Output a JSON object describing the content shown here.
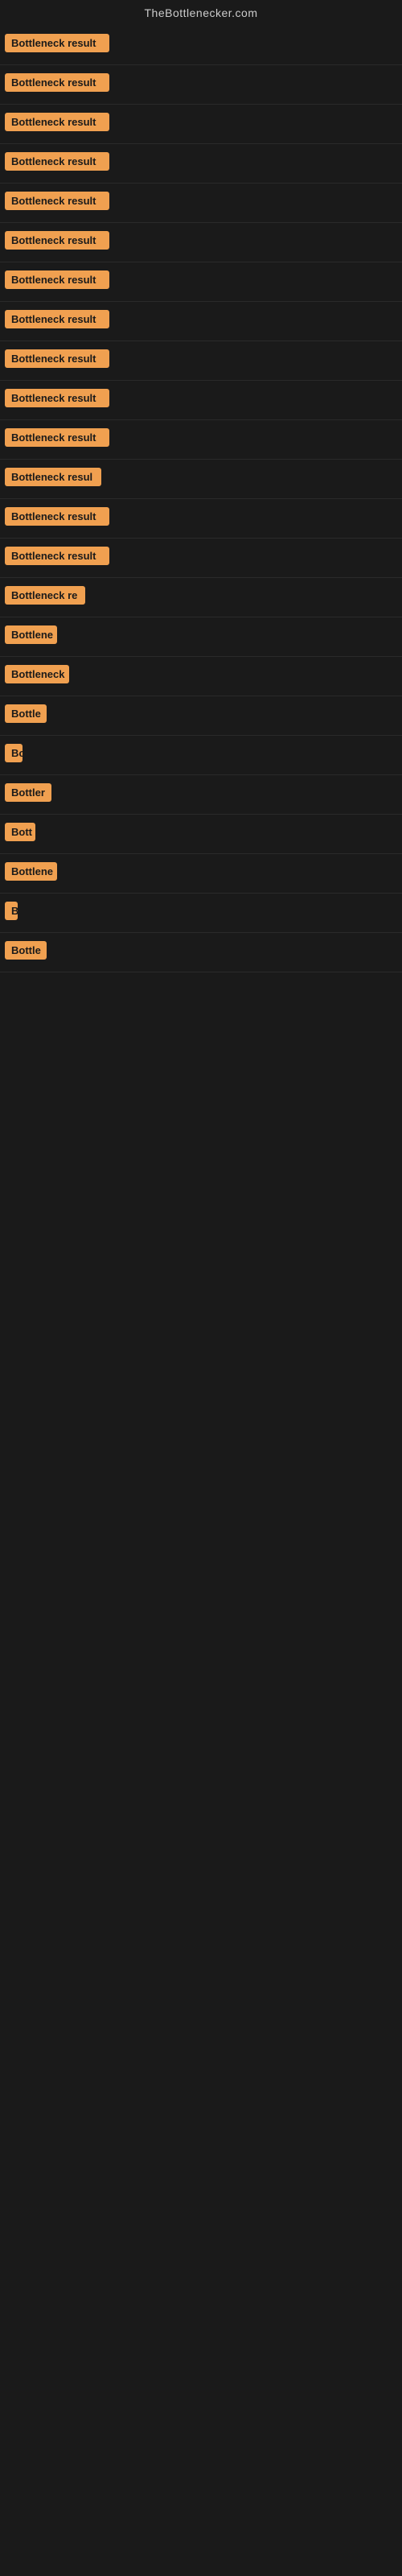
{
  "site": {
    "title": "TheBottlenecker.com"
  },
  "badges": [
    {
      "id": 1,
      "text": "Bottleneck result",
      "visible_chars": 17
    },
    {
      "id": 2,
      "text": "Bottleneck result",
      "visible_chars": 17
    },
    {
      "id": 3,
      "text": "Bottleneck result",
      "visible_chars": 17
    },
    {
      "id": 4,
      "text": "Bottleneck result",
      "visible_chars": 17
    },
    {
      "id": 5,
      "text": "Bottleneck result",
      "visible_chars": 17
    },
    {
      "id": 6,
      "text": "Bottleneck result",
      "visible_chars": 17
    },
    {
      "id": 7,
      "text": "Bottleneck result",
      "visible_chars": 17
    },
    {
      "id": 8,
      "text": "Bottleneck result",
      "visible_chars": 17
    },
    {
      "id": 9,
      "text": "Bottleneck result",
      "visible_chars": 17
    },
    {
      "id": 10,
      "text": "Bottleneck result",
      "visible_chars": 17
    },
    {
      "id": 11,
      "text": "Bottleneck result",
      "visible_chars": 17
    },
    {
      "id": 12,
      "text": "Bottleneck resul",
      "visible_chars": 16
    },
    {
      "id": 13,
      "text": "Bottleneck result",
      "visible_chars": 17
    },
    {
      "id": 14,
      "text": "Bottleneck result",
      "visible_chars": 17
    },
    {
      "id": 15,
      "text": "Bottleneck re",
      "visible_chars": 13
    },
    {
      "id": 16,
      "text": "Bottlene",
      "visible_chars": 8
    },
    {
      "id": 17,
      "text": "Bottleneck",
      "visible_chars": 10
    },
    {
      "id": 18,
      "text": "Bottle",
      "visible_chars": 6
    },
    {
      "id": 19,
      "text": "Bo",
      "visible_chars": 2
    },
    {
      "id": 20,
      "text": "Bottler",
      "visible_chars": 7
    },
    {
      "id": 21,
      "text": "Bott",
      "visible_chars": 4
    },
    {
      "id": 22,
      "text": "Bottlene",
      "visible_chars": 8
    },
    {
      "id": 23,
      "text": "B",
      "visible_chars": 1
    },
    {
      "id": 24,
      "text": "Bottle",
      "visible_chars": 6
    }
  ],
  "widths": [
    130,
    130,
    130,
    130,
    130,
    130,
    130,
    130,
    130,
    130,
    130,
    120,
    130,
    130,
    100,
    65,
    80,
    52,
    22,
    58,
    38,
    65,
    16,
    52
  ]
}
